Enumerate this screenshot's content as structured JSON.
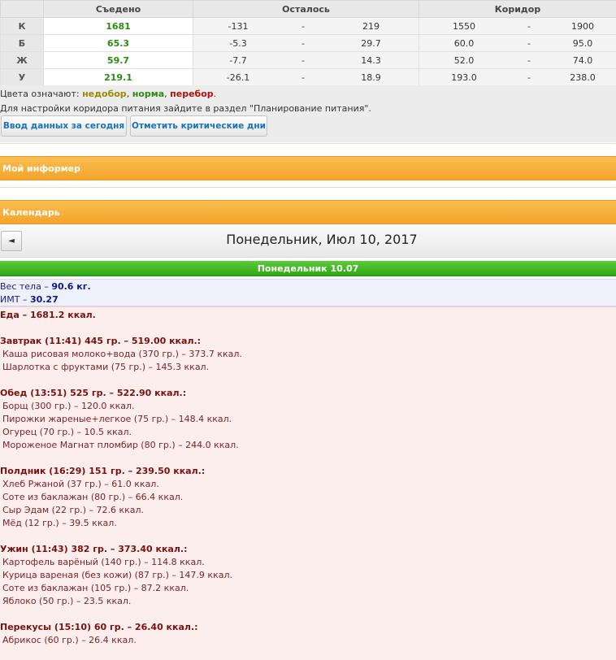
{
  "table": {
    "headers": [
      "",
      "Съедено",
      "Осталось",
      "Коридор"
    ],
    "rows": [
      {
        "label": "К",
        "eaten": "1681",
        "left_from": "-131",
        "left_to": "219",
        "corr_from": "1550",
        "corr_to": "1900"
      },
      {
        "label": "Б",
        "eaten": "65.3",
        "left_from": "-5.3",
        "left_to": "29.7",
        "corr_from": "60.0",
        "corr_to": "95.0"
      },
      {
        "label": "Ж",
        "eaten": "59.7",
        "left_from": "-7.7",
        "left_to": "14.3",
        "corr_from": "52.0",
        "corr_to": "74.0"
      },
      {
        "label": "У",
        "eaten": "219.1",
        "left_from": "-26.1",
        "left_to": "18.9",
        "corr_from": "193.0",
        "corr_to": "238.0"
      }
    ],
    "dash": "-"
  },
  "legend": {
    "prefix": "Цвета означают: ",
    "under": "недобор",
    "sep1": ", ",
    "norm": "норма",
    "sep2": ", ",
    "over": "перебор",
    "end": "."
  },
  "hint": "Для настройки коридора питания зайдите в раздел \"Планирование питания\".",
  "buttons": {
    "enter_today": "Ввод данных за сегодня",
    "critical_days": "Отметить критические дни"
  },
  "informer": {
    "title": "Мой информер"
  },
  "calendar": {
    "title": "Календарь",
    "prev_glyph": "◄",
    "date": "Понедельник, Июл 10, 2017",
    "day_header": "Понедельник 10.07"
  },
  "body": {
    "weight_label": "Вес тела – ",
    "weight_value": "90.6 кг.",
    "bmi_label": "ИМТ – ",
    "bmi_value": "30.27"
  },
  "food": {
    "total": "Еда – 1681.2 ккал.",
    "meals": [
      {
        "header": "Завтрак (11:41) 445 гр. – 519.00 ккал.:",
        "items": [
          "Каша рисовая молоко+вода (370 гр.) – 373.7 ккал.",
          "Шарлотка с фруктами (75 гр.) – 145.3 ккал."
        ]
      },
      {
        "header": "Обед (13:51) 525 гр. – 522.90 ккал.:",
        "items": [
          "Борщ (300 гр.) – 120.0 ккал.",
          "Пирожки жареные+легкое (75 гр.) – 148.4 ккал.",
          "Огурец (70 гр.) – 10.5 ккал.",
          "Мороженое Магнат пломбир (80 гр.) – 244.0 ккал."
        ]
      },
      {
        "header": "Полдник (16:29) 151 гр. – 239.50 ккал.:",
        "items": [
          "Хлеб Ржаной (37 гр.) – 61.0 ккал.",
          "Соте из баклажан (80 гр.) – 66.4 ккал.",
          "Сыр Эдам (22 гр.) – 72.6 ккал.",
          "Мёд (12 гр.) – 39.5 ккал."
        ]
      },
      {
        "header": "Ужин (11:43) 382 гр. – 373.40 ккал.:",
        "items": [
          "Картофель варёный (140 гр.) – 114.8 ккал.",
          "Курица вареная (без кожи) (87 гр.) – 147.9 ккал.",
          "Соте из баклажан (105 гр.) – 87.2 ккал.",
          "Яблоко (50 гр.) – 23.5 ккал."
        ]
      },
      {
        "header": "Перекусы (15:10) 60 гр. – 26.40 ккал.:",
        "items": [
          "Абрикос (60 гр.) – 26.4 ккал."
        ]
      }
    ]
  },
  "colors": {
    "eaten_green": "#2c8a14",
    "under": "#9a8a00",
    "over": "#b01010",
    "orange_bar": "#f4a42a",
    "green_bar": "#2fa616",
    "button_text": "#1a73b5",
    "food_text": "#7b1f1f",
    "body_text": "#1a237e"
  }
}
